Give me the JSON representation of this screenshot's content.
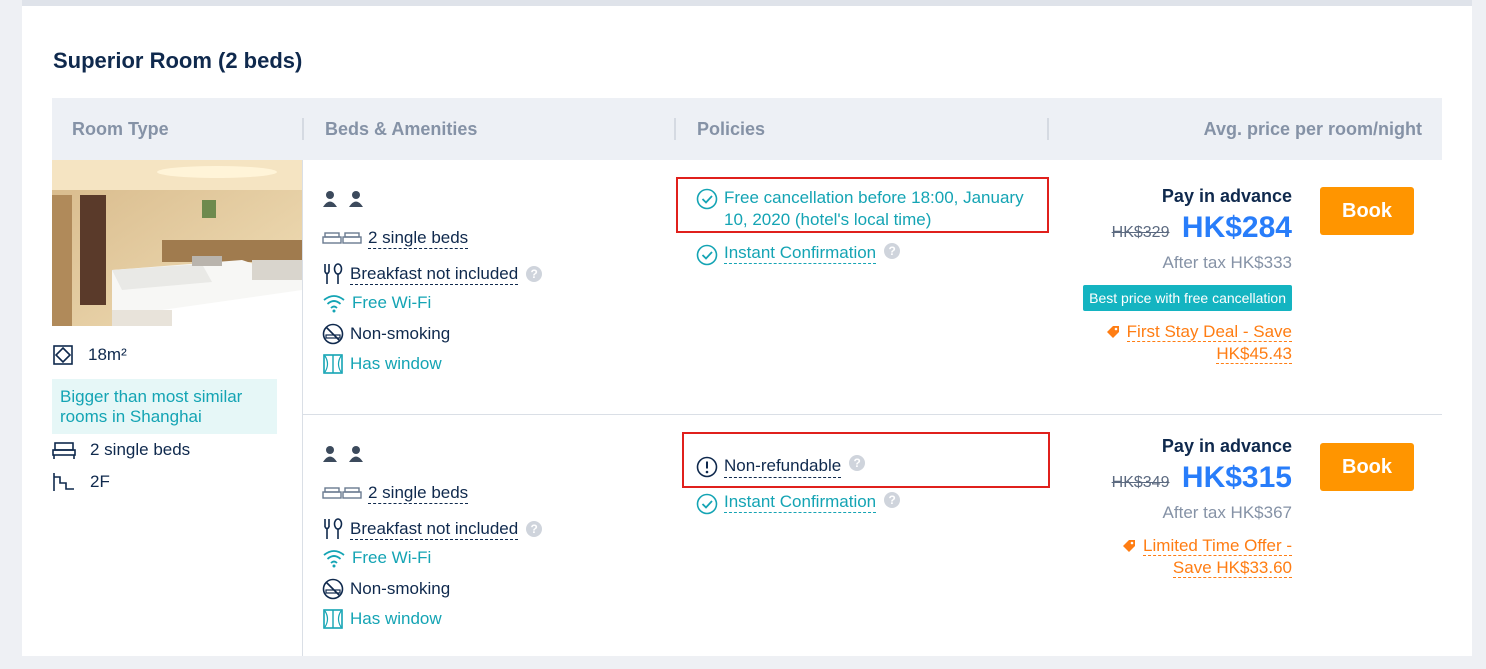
{
  "room": {
    "title": "Superior Room (2 beds)"
  },
  "table_headers": {
    "room_type": "Room Type",
    "beds_amenities": "Beds & Amenities",
    "policies": "Policies",
    "price": "Avg. price per room/night"
  },
  "room_info": {
    "size": "18m²",
    "highlight": "Bigger than most similar rooms in Shanghai",
    "beds": "2 single beds",
    "floor": "2F"
  },
  "options": [
    {
      "beds": "2 single beds",
      "breakfast": "Breakfast not included",
      "wifi": "Free Wi-Fi",
      "smoking": "Non-smoking",
      "window": "Has window",
      "policy_main": "Free cancellation before 18:00, January 10, 2020 (hotel's local time)",
      "policy_confirm": "Instant Confirmation",
      "pay_label": "Pay in advance",
      "old_price": "HK$329",
      "price": "HK$284",
      "after_tax": "After tax HK$333",
      "badge": "Best price with free cancellation",
      "deal_line1": "First Stay Deal - Save",
      "deal_line2": "HK$45.43",
      "book_label": "Book"
    },
    {
      "beds": "2 single beds",
      "breakfast": "Breakfast not included",
      "wifi": "Free Wi-Fi",
      "smoking": "Non-smoking",
      "window": "Has window",
      "policy_main": "Non-refundable",
      "policy_confirm": "Instant Confirmation",
      "pay_label": "Pay in advance",
      "old_price": "HK$349",
      "price": "HK$315",
      "after_tax": "After tax HK$367",
      "deal_line1": "Limited Time Offer -",
      "deal_line2": "Save HK$33.60",
      "book_label": "Book"
    }
  ],
  "colors": {
    "accent": "#287dfa",
    "teal": "#14a4b4",
    "book": "#ff9500",
    "deal": "#ff7d13",
    "highlight_box": "#e0201c"
  },
  "icons": [
    "guest-icon",
    "bed-icon",
    "fork-knife-icon",
    "wifi-icon",
    "no-smoking-icon",
    "window-icon",
    "check-circle-icon",
    "alert-circle-icon",
    "tag-icon",
    "room-size-icon",
    "floor-icon",
    "help-icon"
  ]
}
